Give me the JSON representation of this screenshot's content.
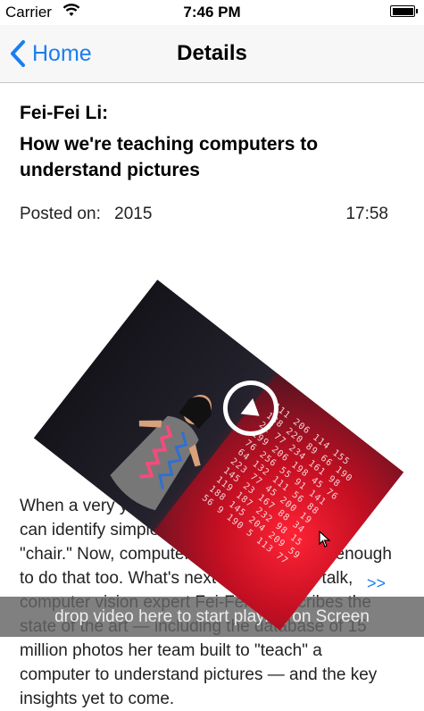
{
  "status_bar": {
    "carrier": "Carrier",
    "time": "7:46 PM",
    "icons": [
      "wifi-icon",
      "battery-icon"
    ]
  },
  "nav": {
    "back_label": "Home",
    "title": "Details",
    "accent_color": "#1a7ef2"
  },
  "talk": {
    "speaker": "Fei-Fei Li:",
    "title": "How we're teaching computers to understand pictures",
    "posted_label": "Posted on:",
    "year": "2015",
    "duration": "17:58",
    "description": "When a very young child looks at a picture, she can identify simple elements: \"cat,\" \"book,\" \"chair.\" Now, computers are getting smart enough to do that too. What's next? In a thrilling talk, computer vision expert Fei-Fei Li describes the state of the art — including the database of 15 million photos her team built to \"teach\" a computer to understand pictures — and the key insights yet to come.",
    "more_link": ">>"
  },
  "video": {
    "play_icon": "play-icon",
    "number_rows": [
      "111 206 114 155",
      "188 220 89 66 190",
      "22 77 234 161 98",
      "199 206 198 45 76",
      "76 256 55 91 141",
      "64 132 111 56 88",
      "223 77 45 200 19",
      "145 23 167 88 34",
      "119 187 232 98 15",
      "188 145 204 209 59",
      "56 9 190 5 113 77"
    ]
  },
  "drop_zone": {
    "text": "drop video here to start playing on Screen"
  }
}
